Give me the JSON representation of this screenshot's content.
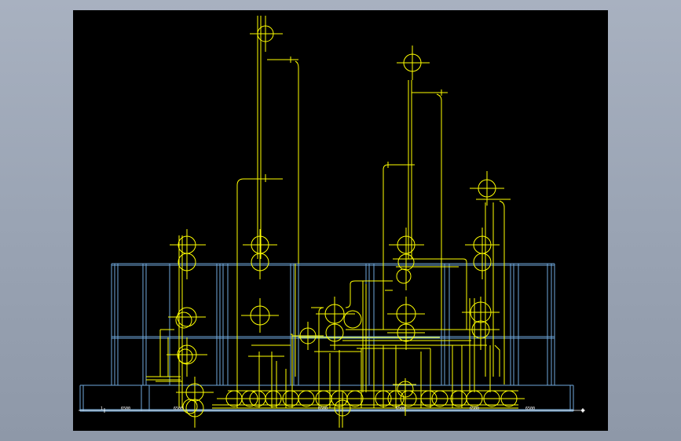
{
  "drawing": {
    "background": "#000000",
    "pipe_color": "#ffff00",
    "structure_color": "#6fa8dc",
    "dim_color": "#ffffff",
    "grid_labels": [
      "1",
      "6500",
      "6500",
      "6500",
      "6500",
      "6500",
      "6500"
    ]
  }
}
